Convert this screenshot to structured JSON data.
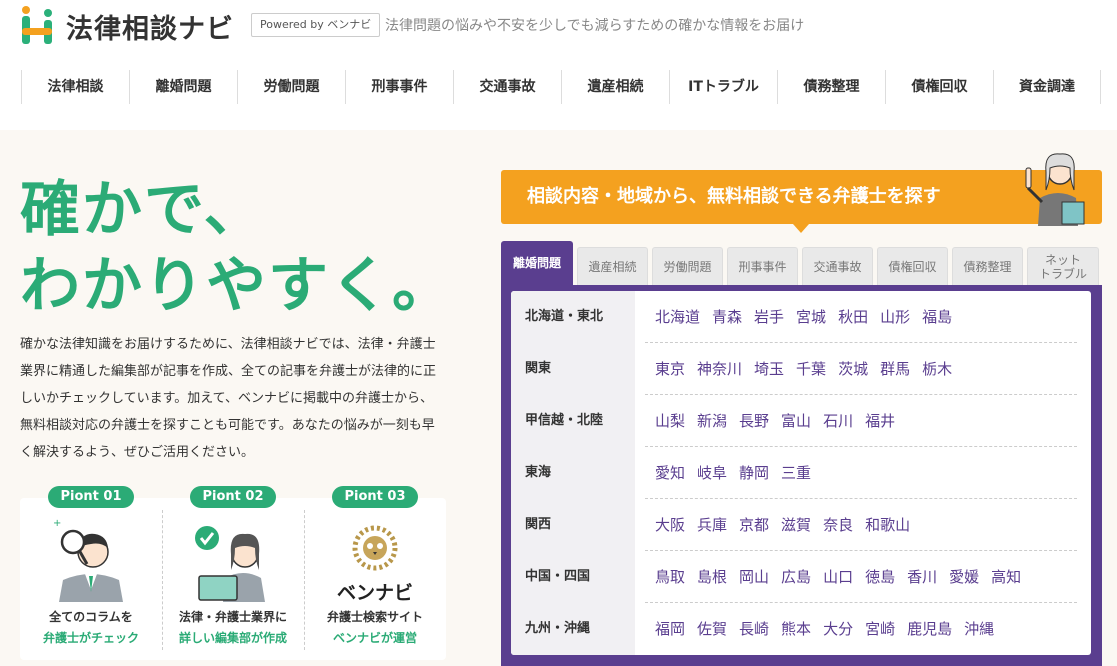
{
  "header": {
    "logo_text": "法律相談ナビ",
    "powered": "Powered by ベンナビ",
    "tagline": "法律問題の悩みや不安を少しでも減らすための確かな情報をお届け"
  },
  "nav": [
    "法律相談",
    "離婚問題",
    "労働問題",
    "刑事事件",
    "交通事故",
    "遺産相続",
    "ITトラブル",
    "債務整理",
    "債権回収",
    "資金調達"
  ],
  "hero": {
    "title_line1": "確かで、",
    "title_line2": "わかりやすく。",
    "description": "確かな法律知識をお届けするために、法律相談ナビでは、法律・弁護士業界に精通した編集部が記事を作成、全ての記事を弁護士が法律的に正しいかチェックしています。加えて、ベンナビに掲載中の弁護士から、無料相談対応の弁護士を探すことも可能です。あなたの悩みが一刻も早く解決するよう、ぜひご活用ください。"
  },
  "points": [
    {
      "badge": "Piont 01",
      "line1": "全てのコラムを",
      "line2": "弁護士がチェック"
    },
    {
      "badge": "Piont 02",
      "line1": "法律・弁護士業界に",
      "line2": "詳しい編集部が作成"
    },
    {
      "badge": "Piont 03",
      "logo": "ベンナビ",
      "line1": "弁護士検索サイト",
      "line2": "ベンナビが運営"
    }
  ],
  "search": {
    "banner": "相談内容・地域から、無料相談できる弁護士を探す",
    "tabs": [
      "離婚問題",
      "遺産相続",
      "労働問題",
      "刑事事件",
      "交通事故",
      "債権回収",
      "債務整理",
      "ネット\nトラブル"
    ],
    "active_tab": "離婚問題",
    "regions": [
      {
        "name": "北海道・東北",
        "prefs": [
          "北海道",
          "青森",
          "岩手",
          "宮城",
          "秋田",
          "山形",
          "福島"
        ]
      },
      {
        "name": "関東",
        "prefs": [
          "東京",
          "神奈川",
          "埼玉",
          "千葉",
          "茨城",
          "群馬",
          "栃木"
        ]
      },
      {
        "name": "甲信越・北陸",
        "prefs": [
          "山梨",
          "新潟",
          "長野",
          "富山",
          "石川",
          "福井"
        ]
      },
      {
        "name": "東海",
        "prefs": [
          "愛知",
          "岐阜",
          "静岡",
          "三重"
        ]
      },
      {
        "name": "関西",
        "prefs": [
          "大阪",
          "兵庫",
          "京都",
          "滋賀",
          "奈良",
          "和歌山"
        ]
      },
      {
        "name": "中国・四国",
        "prefs": [
          "鳥取",
          "島根",
          "岡山",
          "広島",
          "山口",
          "徳島",
          "香川",
          "愛媛",
          "高知"
        ]
      },
      {
        "name": "九州・沖縄",
        "prefs": [
          "福岡",
          "佐賀",
          "長崎",
          "熊本",
          "大分",
          "宮崎",
          "鹿児島",
          "沖縄"
        ]
      }
    ]
  },
  "colors": {
    "accent_green": "#2bab76",
    "accent_orange": "#f4a11f",
    "accent_purple": "#5a3e8f"
  },
  "icons": [
    "logo-mark-icon",
    "magnifier-person-icon",
    "check-person-icon",
    "bennavi-owl-icon",
    "pointing-woman-icon"
  ]
}
